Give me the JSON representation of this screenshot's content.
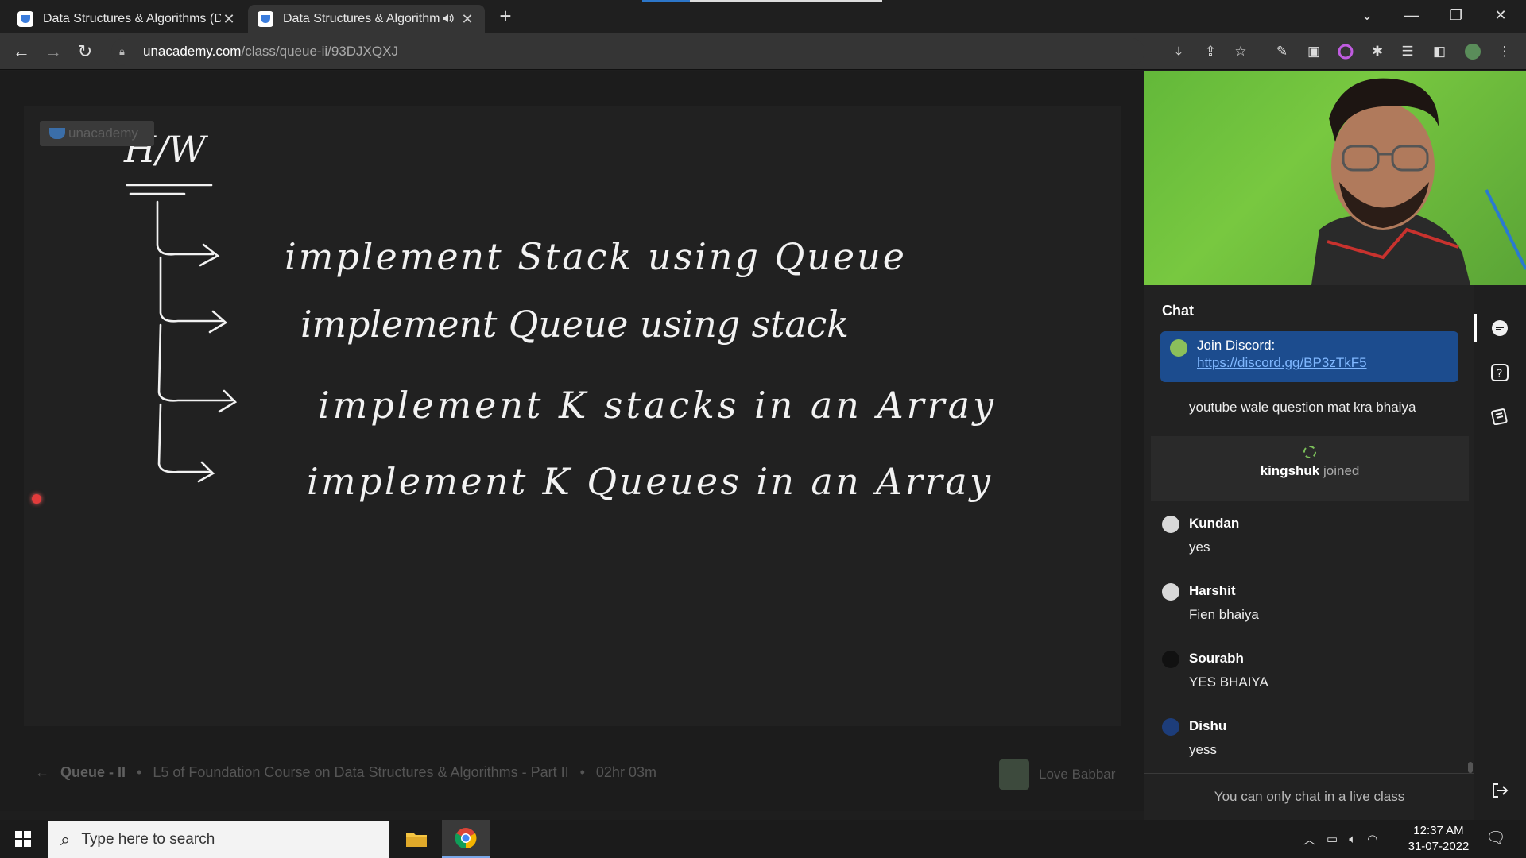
{
  "browser": {
    "tabs": [
      {
        "title": "Data Structures & Algorithms (DS",
        "active": false
      },
      {
        "title": "Data Structures & Algorithm",
        "active": true
      }
    ],
    "url_host": "unacademy.com",
    "url_path": "/class/queue-ii/93DJXQXJ"
  },
  "board": {
    "watermark": "unacademy",
    "heading": "H/W",
    "tasks": [
      "implement Stack using Queue",
      "implement Queue using stack",
      "implement K stacks in an Array",
      "implement K Queues in an Array"
    ]
  },
  "lecture": {
    "title": "Queue - II",
    "course": "L5 of Foundation Course on Data Structures & Algorithms - Part II",
    "duration": "02hr 03m",
    "educator": "Love Babbar"
  },
  "chat": {
    "title": "Chat",
    "pinned_title": "Join Discord:",
    "pinned_link": "https://discord.gg/BP3zTkF5",
    "partial_message": "youtube  wale question mat kra bhaiya",
    "join_user": "kingshuk",
    "join_action": "joined",
    "messages": [
      {
        "name": "Kundan",
        "text": "yes"
      },
      {
        "name": "Harshit",
        "text": "Fien bhaiya"
      },
      {
        "name": "Sourabh",
        "text": "YES BHAIYA"
      },
      {
        "name": "Dishu",
        "text": "yess"
      }
    ],
    "footer": "You can only chat in a live class"
  },
  "taskbar": {
    "search_placeholder": "Type here to search",
    "time": "12:37 AM",
    "date": "31-07-2022"
  },
  "colors": {
    "pinned_bg": "#1c4c8e",
    "laser": "#e23b3b",
    "video_green": "#6cbd3c"
  }
}
